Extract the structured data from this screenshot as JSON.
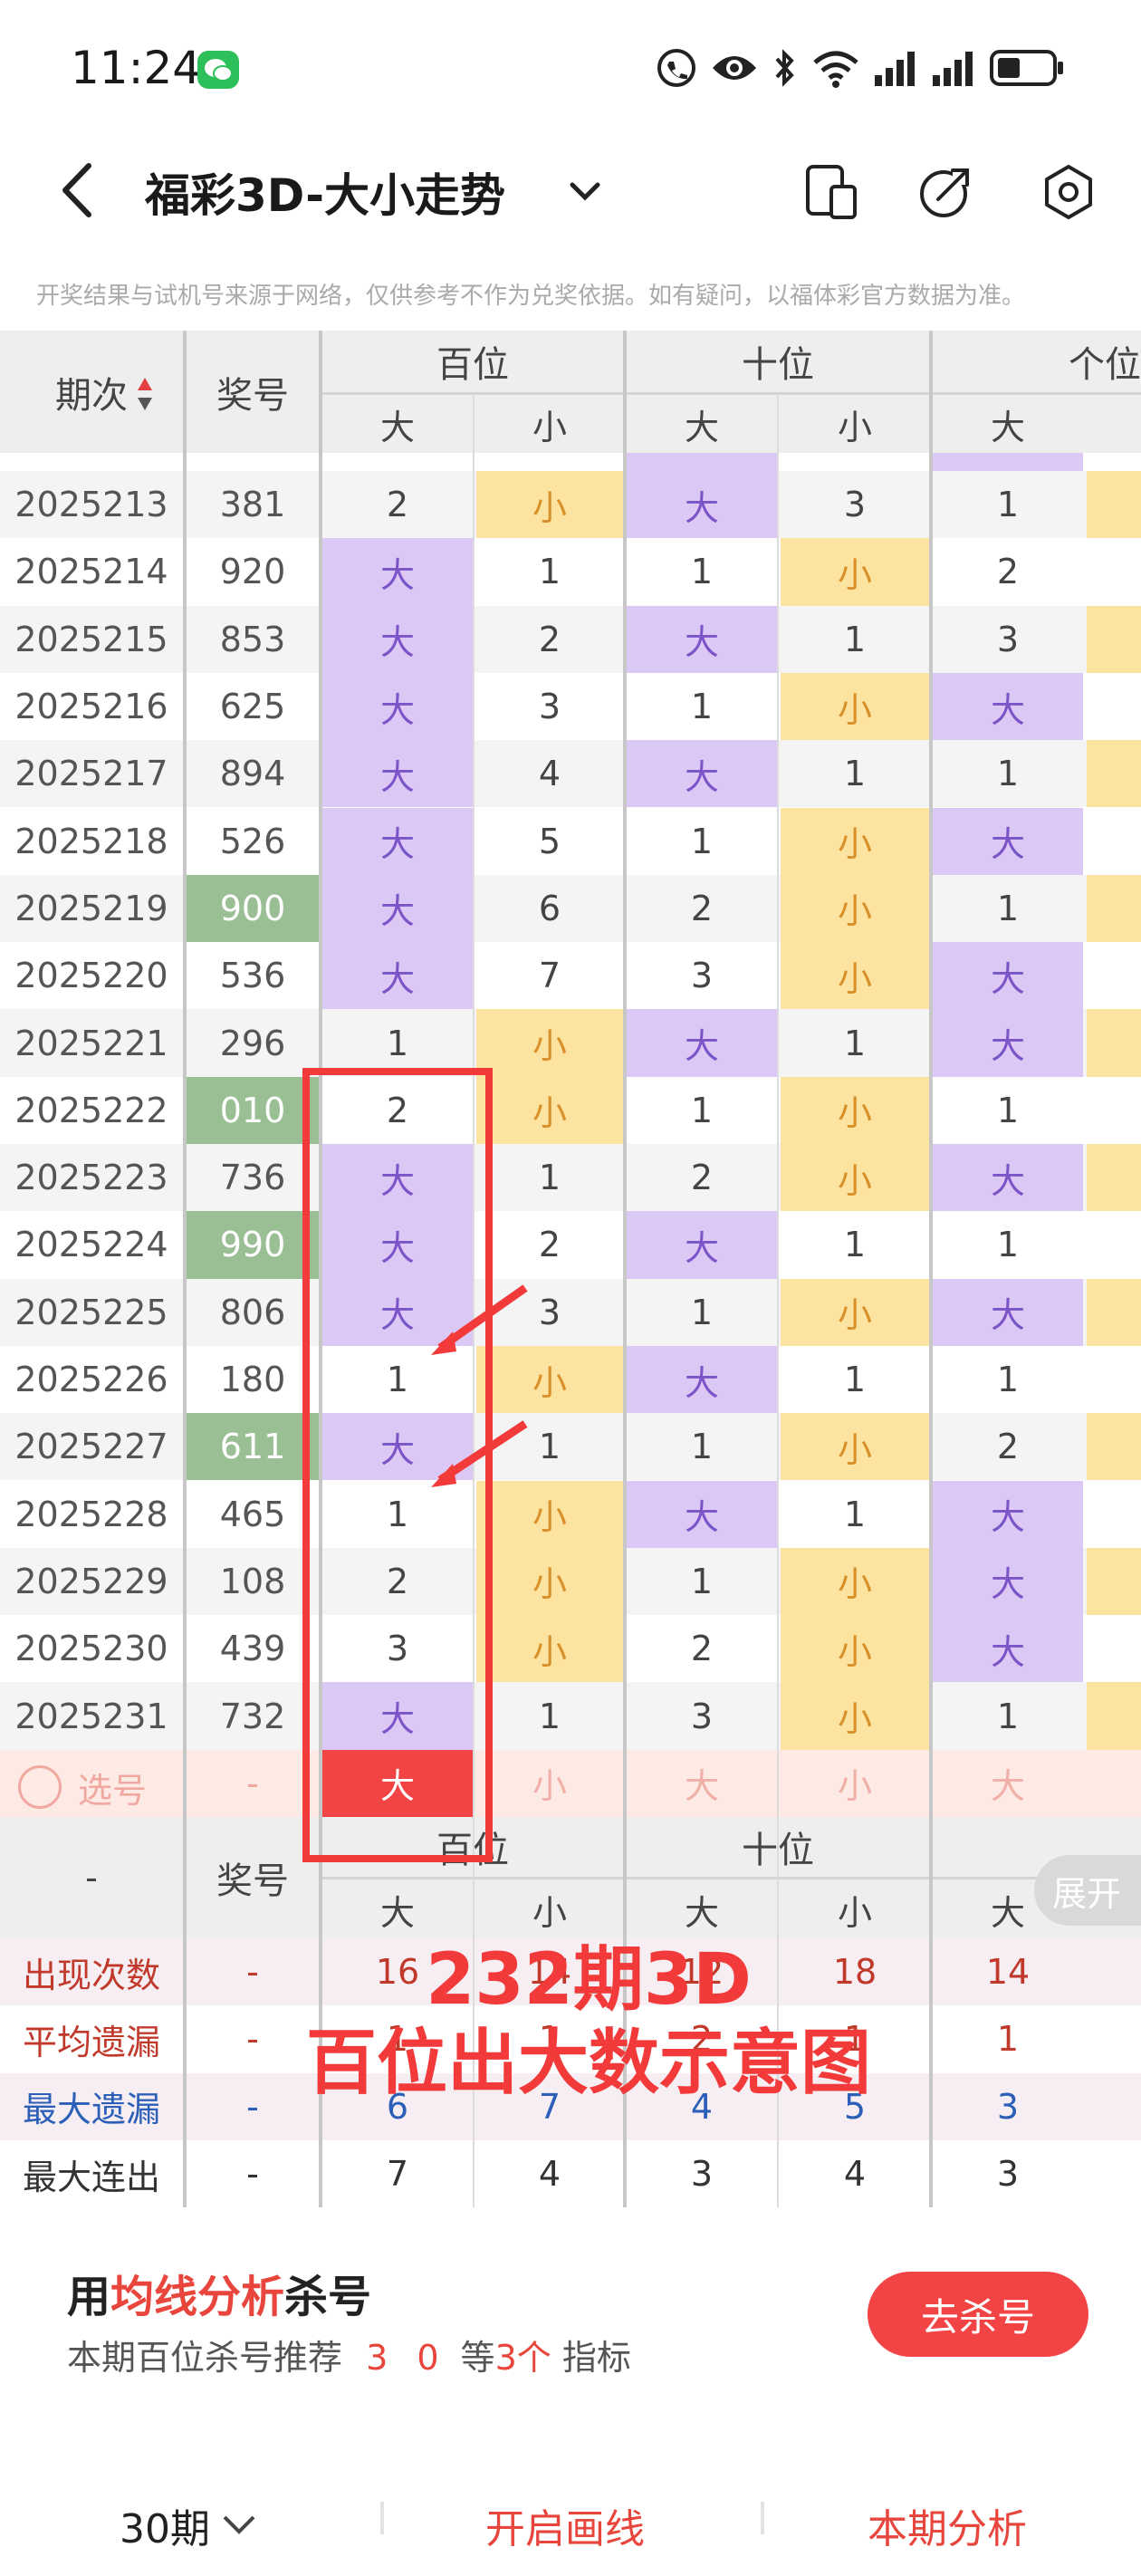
{
  "status_bar": {
    "time": "11:24"
  },
  "header": {
    "title": "福彩3D-大小走势"
  },
  "notice": "开奖结果与试机号来源于网络，仅供参考不作为兑奖依据。如有疑问，以福体彩官方数据为准。",
  "table": {
    "col_period": "期次",
    "col_prize": "奖号",
    "groups": [
      "百位",
      "十位",
      "个位"
    ],
    "big": "大",
    "small": "小",
    "rows": [
      {
        "period": "2025213",
        "prize": "381",
        "prize_hl": false,
        "b1": "2",
        "s1": "小",
        "b2": "大",
        "s2": "3",
        "b3": "1"
      },
      {
        "period": "2025214",
        "prize": "920",
        "prize_hl": false,
        "b1": "大",
        "s1": "1",
        "b2": "1",
        "s2": "小",
        "b3": "2"
      },
      {
        "period": "2025215",
        "prize": "853",
        "prize_hl": false,
        "b1": "大",
        "s1": "2",
        "b2": "大",
        "s2": "1",
        "b3": "3"
      },
      {
        "period": "2025216",
        "prize": "625",
        "prize_hl": false,
        "b1": "大",
        "s1": "3",
        "b2": "1",
        "s2": "小",
        "b3": "大"
      },
      {
        "period": "2025217",
        "prize": "894",
        "prize_hl": false,
        "b1": "大",
        "s1": "4",
        "b2": "大",
        "s2": "1",
        "b3": "1"
      },
      {
        "period": "2025218",
        "prize": "526",
        "prize_hl": false,
        "b1": "大",
        "s1": "5",
        "b2": "1",
        "s2": "小",
        "b3": "大"
      },
      {
        "period": "2025219",
        "prize": "900",
        "prize_hl": true,
        "b1": "大",
        "s1": "6",
        "b2": "2",
        "s2": "小",
        "b3": "1"
      },
      {
        "period": "2025220",
        "prize": "536",
        "prize_hl": false,
        "b1": "大",
        "s1": "7",
        "b2": "3",
        "s2": "小",
        "b3": "大"
      },
      {
        "period": "2025221",
        "prize": "296",
        "prize_hl": false,
        "b1": "1",
        "s1": "小",
        "b2": "大",
        "s2": "1",
        "b3": "大"
      },
      {
        "period": "2025222",
        "prize": "010",
        "prize_hl": true,
        "b1": "2",
        "s1": "小",
        "b2": "1",
        "s2": "小",
        "b3": "1"
      },
      {
        "period": "2025223",
        "prize": "736",
        "prize_hl": false,
        "b1": "大",
        "s1": "1",
        "b2": "2",
        "s2": "小",
        "b3": "大"
      },
      {
        "period": "2025224",
        "prize": "990",
        "prize_hl": true,
        "b1": "大",
        "s1": "2",
        "b2": "大",
        "s2": "1",
        "b3": "1"
      },
      {
        "period": "2025225",
        "prize": "806",
        "prize_hl": false,
        "b1": "大",
        "s1": "3",
        "b2": "1",
        "s2": "小",
        "b3": "大"
      },
      {
        "period": "2025226",
        "prize": "180",
        "prize_hl": false,
        "b1": "1",
        "s1": "小",
        "b2": "大",
        "s2": "1",
        "b3": "1"
      },
      {
        "period": "2025227",
        "prize": "611",
        "prize_hl": true,
        "b1": "大",
        "s1": "1",
        "b2": "1",
        "s2": "小",
        "b3": "2"
      },
      {
        "period": "2025228",
        "prize": "465",
        "prize_hl": false,
        "b1": "1",
        "s1": "小",
        "b2": "大",
        "s2": "1",
        "b3": "大"
      },
      {
        "period": "2025229",
        "prize": "108",
        "prize_hl": false,
        "b1": "2",
        "s1": "小",
        "b2": "1",
        "s2": "小",
        "b3": "大"
      },
      {
        "period": "2025230",
        "prize": "439",
        "prize_hl": false,
        "b1": "3",
        "s1": "小",
        "b2": "2",
        "s2": "小",
        "b3": "大"
      },
      {
        "period": "2025231",
        "prize": "732",
        "prize_hl": false,
        "b1": "大",
        "s1": "1",
        "b2": "3",
        "s2": "小",
        "b3": "1"
      }
    ],
    "select_row": {
      "label": "选号",
      "dash": "-",
      "vals": [
        "大",
        "小",
        "大",
        "小",
        "大"
      ]
    },
    "footer_header": {
      "dash": "-",
      "prize": "奖号",
      "expand": "展开"
    },
    "stats": [
      {
        "label": "出现次数",
        "dash": "-",
        "vals": [
          "16",
          "14",
          "12",
          "18",
          "14"
        ],
        "color": "#c0392b"
      },
      {
        "label": "平均遗漏",
        "dash": "-",
        "vals": [
          "1",
          "1",
          "2",
          "1",
          "1"
        ],
        "color": "#c0392b"
      },
      {
        "label": "最大遗漏",
        "dash": "-",
        "vals": [
          "6",
          "7",
          "4",
          "5",
          "3"
        ],
        "color": "#2c5fb8"
      },
      {
        "label": "最大连出",
        "dash": "-",
        "vals": [
          "7",
          "4",
          "3",
          "4",
          "3"
        ],
        "color": "#333333"
      }
    ]
  },
  "annotation": {
    "line1": "232期3D",
    "line2": "百位出大数示意图"
  },
  "promo": {
    "title_a": "用",
    "title_b": "均线分析",
    "title_c": "杀号",
    "sub_a": "本期百位杀号推荐",
    "sub_nums": "3 0",
    "sub_b": "等",
    "sub_count": "3个",
    "sub_c": "指标",
    "button": "去杀号"
  },
  "footer": {
    "periods": "30期",
    "draw": "开启画线",
    "analysis": "本期分析"
  },
  "colors": {
    "purple": "#dcc8f5",
    "yellow": "#fde3a0",
    "green": "#9bbf95",
    "red": "#f24444",
    "accent_red": "#e8453c"
  }
}
